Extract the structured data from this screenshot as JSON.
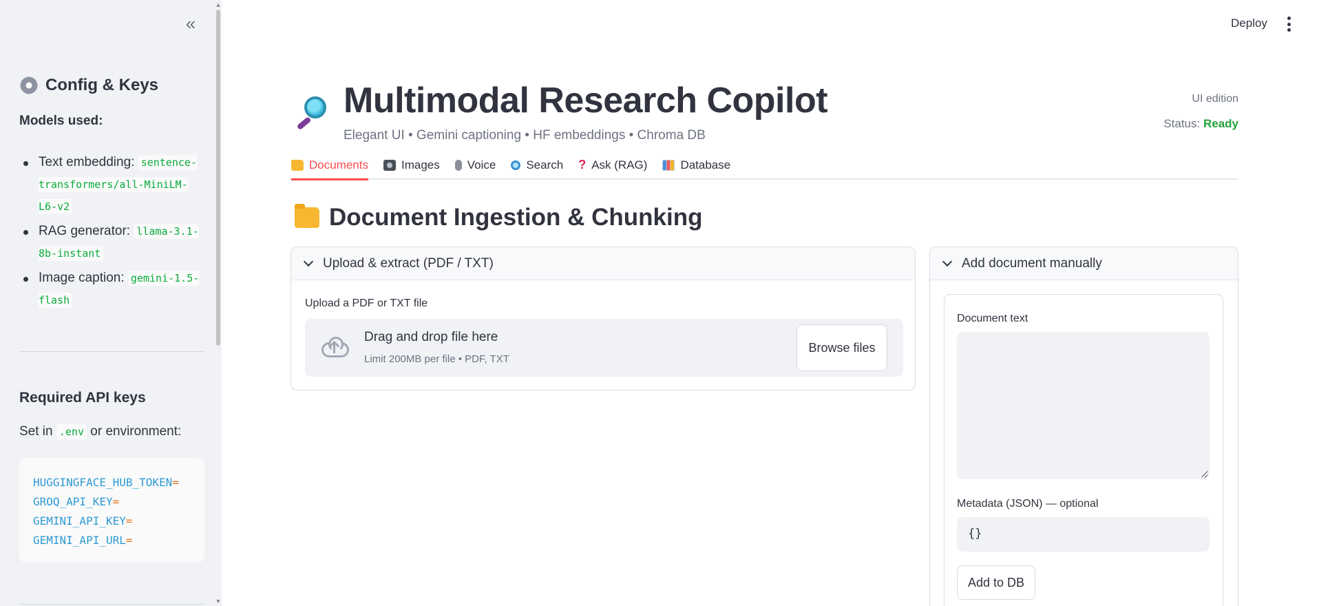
{
  "sidebar": {
    "title": "Config & Keys",
    "models_heading": "Models used:",
    "models": [
      {
        "label": "Text embedding:",
        "value": "sentence-transformers/all-MiniLM-L6-v2"
      },
      {
        "label": "RAG generator:",
        "value": "llama-3.1-8b-instant"
      },
      {
        "label": "Image caption:",
        "value": "gemini-1.5-flash"
      }
    ],
    "keys_heading": "Required API keys",
    "set_in_prefix": "Set in",
    "set_in_code": ".env",
    "set_in_suffix": "or environment:",
    "env_keys": [
      "HUGGINGFACE_HUB_TOKEN",
      "GROQ_API_KEY",
      "GEMINI_API_KEY",
      "GEMINI_API_URL"
    ],
    "env_eq": "="
  },
  "header": {
    "deploy_label": "Deploy"
  },
  "hero": {
    "title": "Multimodal Research Copilot",
    "subtitle": "Elegant UI • Gemini captioning • HF embeddings • Chroma DB",
    "edition": "UI edition",
    "status_label": "Status:",
    "status_value": "Ready"
  },
  "tabs": [
    {
      "label": "Documents",
      "icon": "folder-icon",
      "active": true
    },
    {
      "label": "Images",
      "icon": "camera-icon"
    },
    {
      "label": "Voice",
      "icon": "microphone-icon"
    },
    {
      "label": "Search",
      "icon": "magnifier-icon"
    },
    {
      "label": "Ask (RAG)",
      "icon": "question-icon"
    },
    {
      "label": "Database",
      "icon": "bar-chart-icon"
    }
  ],
  "section": {
    "title": "Document Ingestion & Chunking"
  },
  "upload": {
    "header": "Upload & extract (PDF / TXT)",
    "label": "Upload a PDF or TXT file",
    "drop_text": "Drag and drop file here",
    "limit_text": "Limit 200MB per file • PDF, TXT",
    "browse_label": "Browse files"
  },
  "manual": {
    "header": "Add document manually",
    "doc_text_label": "Document text",
    "doc_text_value": "",
    "metadata_label": "Metadata (JSON) — optional",
    "metadata_value": "{}",
    "add_button": "Add to DB"
  },
  "colors": {
    "accent": "#ff4b4b",
    "status_ready": "#21a038",
    "sidebar_bg": "#f0f2f6",
    "code_green": "#09ab3b"
  }
}
